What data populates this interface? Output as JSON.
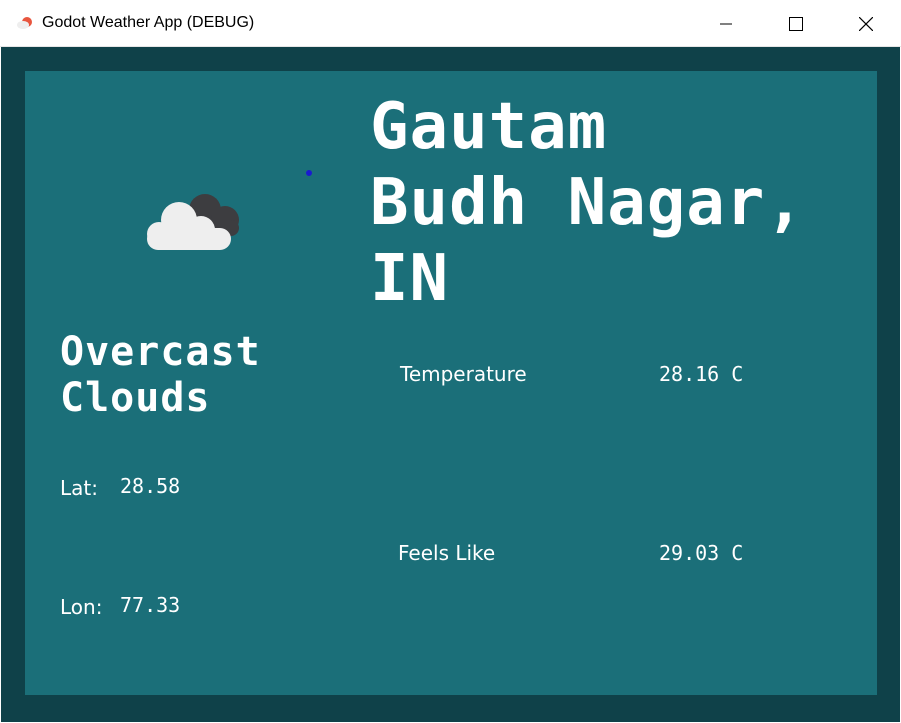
{
  "window": {
    "title": "Godot Weather App (DEBUG)"
  },
  "weather": {
    "city_lines": [
      "Gautam",
      "Budh Nagar,",
      "IN"
    ],
    "description_lines": [
      "Overcast",
      "Clouds"
    ],
    "icon": "cloud-overcast-icon",
    "lat_label": "Lat:",
    "lat_value": "28.58",
    "lon_label": "Lon:",
    "lon_value": "77.33",
    "temperature_label": "Temperature",
    "temperature_value": "28.16 C",
    "feels_like_label": "Feels Like",
    "feels_like_value": "29.03 C"
  },
  "colors": {
    "outer_bg": "#0f4149",
    "panel_bg": "#1b6f79",
    "text": "#ffffff"
  }
}
